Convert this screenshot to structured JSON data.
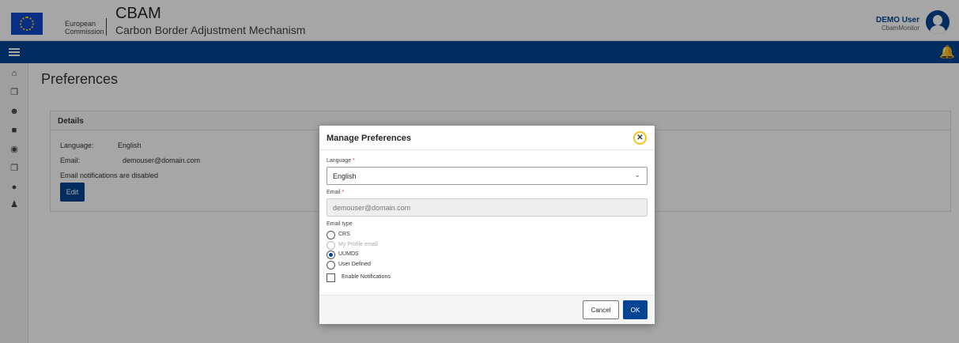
{
  "header": {
    "org_line1": "European",
    "org_line2": "Commission",
    "app_title": "CBAM",
    "app_subtitle": "Carbon Border Adjustment Mechanism",
    "user_name": "DEMO User",
    "user_role": "CbamMonitor"
  },
  "nav": {
    "menu_icon": "hamburger-icon",
    "notification_icon": "bell-icon"
  },
  "siderail": {
    "icons": [
      "home-icon",
      "copy-icon",
      "users-icon",
      "briefcase-icon",
      "user-circle-icon",
      "copy-icon",
      "chat-icon",
      "person-icon"
    ]
  },
  "page": {
    "title": "Preferences"
  },
  "details": {
    "heading": "Details",
    "language_label": "Language:",
    "language_value": "English",
    "email_label": "Email:",
    "email_value": "demouser@domain.com",
    "notifications_text": "Email notifications are disabled",
    "edit_label": "Edit"
  },
  "modal": {
    "title": "Manage Preferences",
    "close_icon": "close-icon",
    "language_label": "Language",
    "language_selected": "English",
    "email_label": "Email",
    "email_value": "demouser@domain.com",
    "email_type_label": "Email type",
    "required_mark": "*",
    "email_types": [
      {
        "label": "CRS",
        "checked": false,
        "disabled": false
      },
      {
        "label": "My Profile email",
        "checked": false,
        "disabled": true
      },
      {
        "label": "UUMDS",
        "checked": true,
        "disabled": false
      },
      {
        "label": "User Defined",
        "checked": false,
        "disabled": false
      }
    ],
    "enable_notifications_label": "Enable Notifications",
    "enable_notifications_checked": false,
    "cancel_label": "Cancel",
    "ok_label": "OK"
  }
}
